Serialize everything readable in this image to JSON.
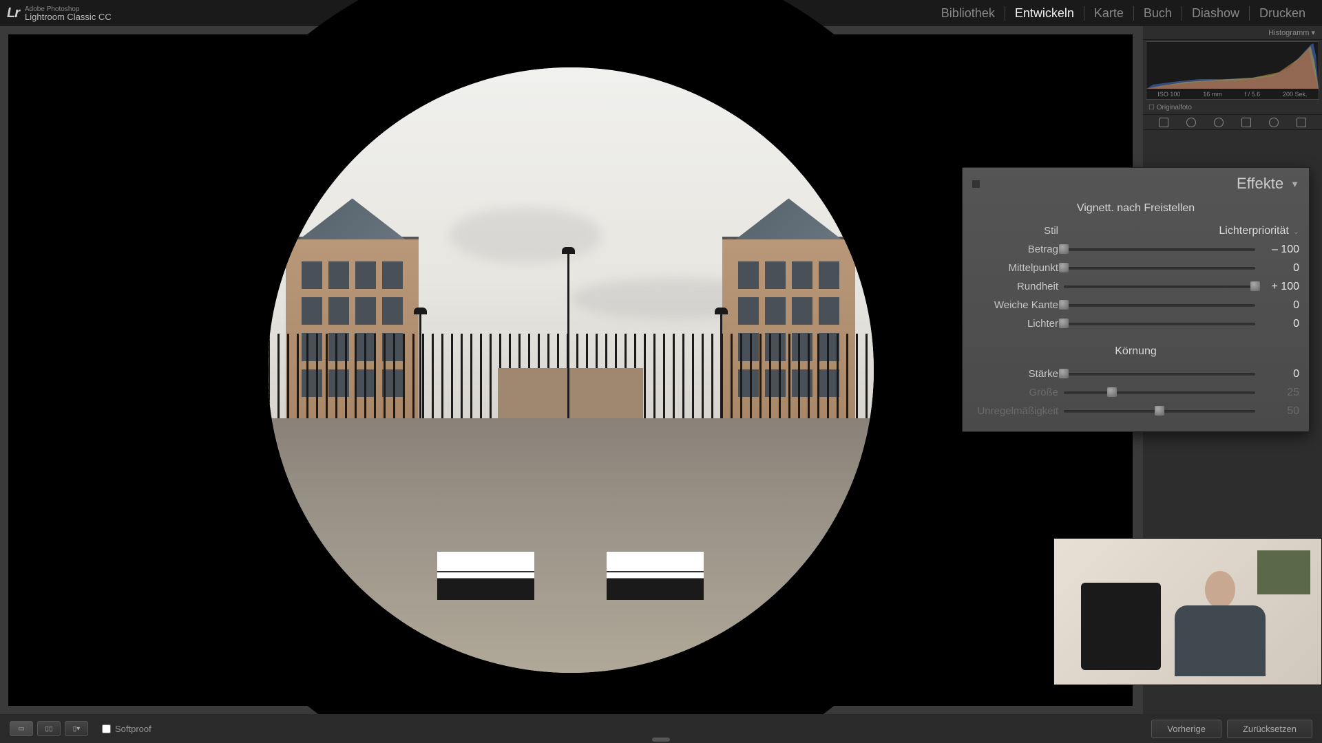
{
  "app": {
    "vendor": "Adobe Photoshop",
    "name": "Lightroom Classic CC"
  },
  "modules": {
    "items": [
      "Bibliothek",
      "Entwickeln",
      "Karte",
      "Buch",
      "Diashow",
      "Drucken"
    ],
    "active": 1
  },
  "histogram": {
    "title": "Histogramm",
    "iso": "ISO 100",
    "focal": "16 mm",
    "aperture": "f / 5.6",
    "shutter": "200 Sek.",
    "originalfoto": "Originalfoto"
  },
  "effects": {
    "title": "Effekte",
    "vignette": {
      "section": "Vignett. nach Freistellen",
      "style_label": "Stil",
      "style_value": "Lichterpriorität",
      "sliders": [
        {
          "label": "Betrag",
          "value": "– 100",
          "pos": 0
        },
        {
          "label": "Mittelpunkt",
          "value": "0",
          "pos": 0
        },
        {
          "label": "Rundheit",
          "value": "+ 100",
          "pos": 100
        },
        {
          "label": "Weiche Kante",
          "value": "0",
          "pos": 0
        },
        {
          "label": "Lichter",
          "value": "0",
          "pos": 0
        }
      ]
    },
    "grain": {
      "section": "Körnung",
      "sliders": [
        {
          "label": "Stärke",
          "value": "0",
          "pos": 0,
          "dim": false
        },
        {
          "label": "Größe",
          "value": "25",
          "pos": 25,
          "dim": true
        },
        {
          "label": "Unregelmäßigkeit",
          "value": "50",
          "pos": 50,
          "dim": true
        }
      ]
    }
  },
  "toolbar": {
    "softproof": "Softproof",
    "prev": "Vorherige",
    "reset": "Zurücksetzen"
  }
}
